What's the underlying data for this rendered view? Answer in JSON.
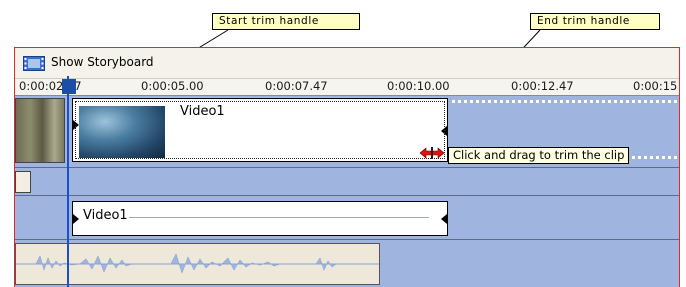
{
  "callouts": {
    "start_trim": "Start trim handle",
    "end_trim": "End trim handle",
    "tooltip": "Click and drag to trim the clip"
  },
  "toolbar": {
    "show_storyboard_label": "Show Storyboard",
    "storyboard_icon": "filmstrip-icon"
  },
  "ruler": {
    "labels": [
      "0:00:02.47",
      "0:00:05.00",
      "0:00:07.47",
      "0:00:10.00",
      "0:00:12.47",
      "0:00:15"
    ]
  },
  "video_track": {
    "clip_name": "Video1"
  },
  "title_track": {
    "clip_name": "Video1"
  },
  "colors": {
    "track_bg": "#9fb5e0",
    "frame_border": "#e02828",
    "playhead": "#1a4fd0",
    "callout_bg": "#ffffc4",
    "trim_cursor": "#e01010"
  }
}
